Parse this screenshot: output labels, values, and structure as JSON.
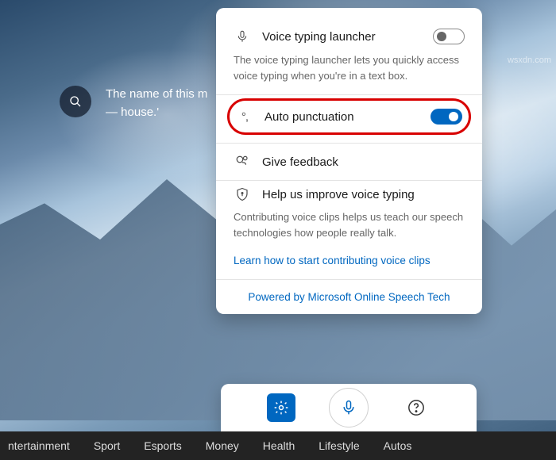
{
  "background": {
    "search_text": "The name of this m— house.'"
  },
  "panel": {
    "launcher": {
      "label": "Voice typing launcher",
      "desc": "The voice typing launcher lets you quickly access voice typing when you're in a text box.",
      "on": false
    },
    "autopunct": {
      "label": "Auto punctuation",
      "on": true
    },
    "feedback": {
      "label": "Give feedback"
    },
    "improve": {
      "label": "Help us improve voice typing",
      "desc": "Contributing voice clips helps us teach our speech technologies how people really talk.",
      "link": "Learn how to start contributing voice clips"
    },
    "footer": "Powered by Microsoft Online Speech Tech"
  },
  "nav": {
    "items": [
      "ntertainment",
      "Sport",
      "Esports",
      "Money",
      "Health",
      "Lifestyle",
      "Autos"
    ]
  },
  "watermark": "wsxdn.com",
  "icons": {
    "search": "search-icon",
    "mic": "mic-icon",
    "punct": "punctuation-icon",
    "feedback": "feedback-icon",
    "shield": "shield-icon",
    "gear": "gear-icon",
    "help": "help-icon"
  }
}
